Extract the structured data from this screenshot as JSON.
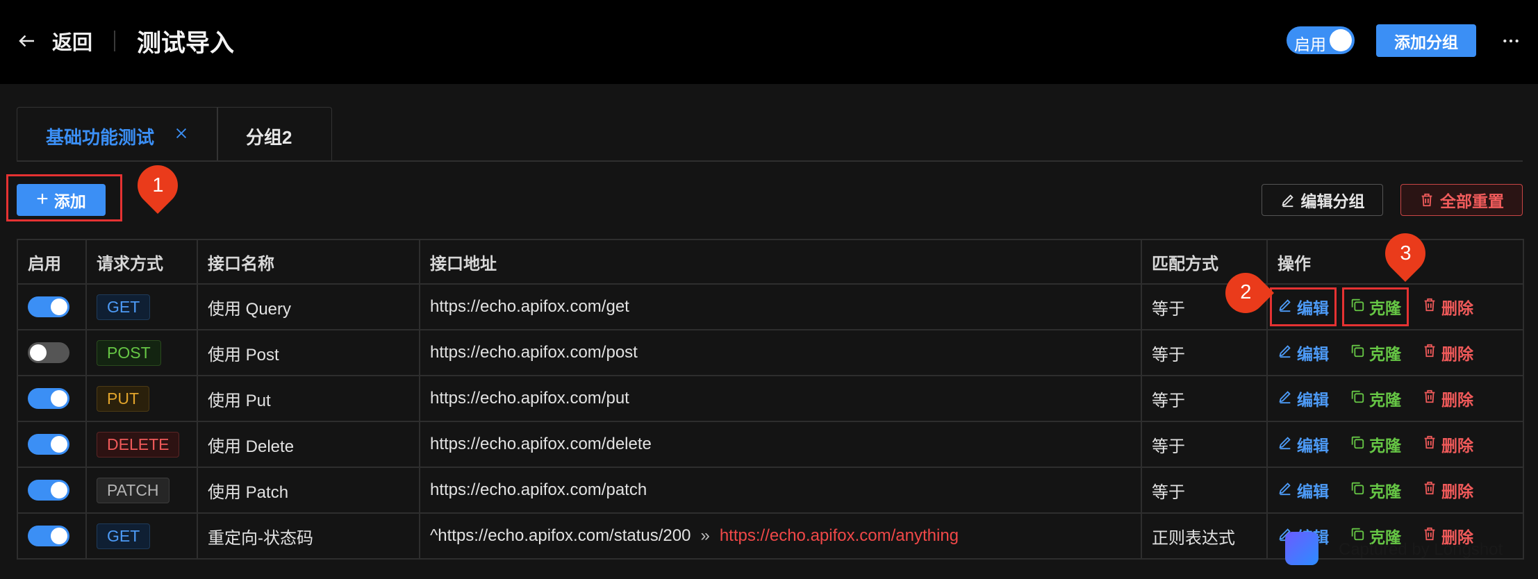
{
  "header": {
    "back_label": "返回",
    "title": "测试导入",
    "enable_label": "启用",
    "add_group_label": "添加分组"
  },
  "tabs": [
    {
      "label": "基础功能测试",
      "active": true
    },
    {
      "label": "分组2",
      "active": false
    }
  ],
  "toolbar": {
    "add_label": "添加",
    "edit_group_label": "编辑分组",
    "reset_all_label": "全部重置"
  },
  "markers": [
    "1",
    "2",
    "3"
  ],
  "table": {
    "columns": [
      "启用",
      "请求方式",
      "接口名称",
      "接口地址",
      "匹配方式",
      "操作"
    ],
    "rows": [
      {
        "enabled": true,
        "method": "GET",
        "name": "使用 Query",
        "url": "https://echo.apifox.com/get",
        "redirect": "",
        "match": "等于"
      },
      {
        "enabled": false,
        "method": "POST",
        "name": "使用 Post",
        "url": "https://echo.apifox.com/post",
        "redirect": "",
        "match": "等于"
      },
      {
        "enabled": true,
        "method": "PUT",
        "name": "使用 Put",
        "url": "https://echo.apifox.com/put",
        "redirect": "",
        "match": "等于"
      },
      {
        "enabled": true,
        "method": "DELETE",
        "name": "使用 Delete",
        "url": "https://echo.apifox.com/delete",
        "redirect": "",
        "match": "等于"
      },
      {
        "enabled": true,
        "method": "PATCH",
        "name": "使用 Patch",
        "url": "https://echo.apifox.com/patch",
        "redirect": "",
        "match": "等于"
      },
      {
        "enabled": true,
        "method": "GET",
        "name": "重定向-状态码",
        "url": "^https://echo.apifox.com/status/200",
        "redirect": "https://echo.apifox.com/anything",
        "match": "正则表达式"
      }
    ],
    "actions": {
      "edit": "编辑",
      "clone": "克隆",
      "delete": "删除"
    }
  },
  "watermark": "Captured by Longshot",
  "colors": {
    "accent": "#3b8ff5",
    "danger": "#f05a5a",
    "success": "#66c645",
    "highlight": "#e53232"
  }
}
